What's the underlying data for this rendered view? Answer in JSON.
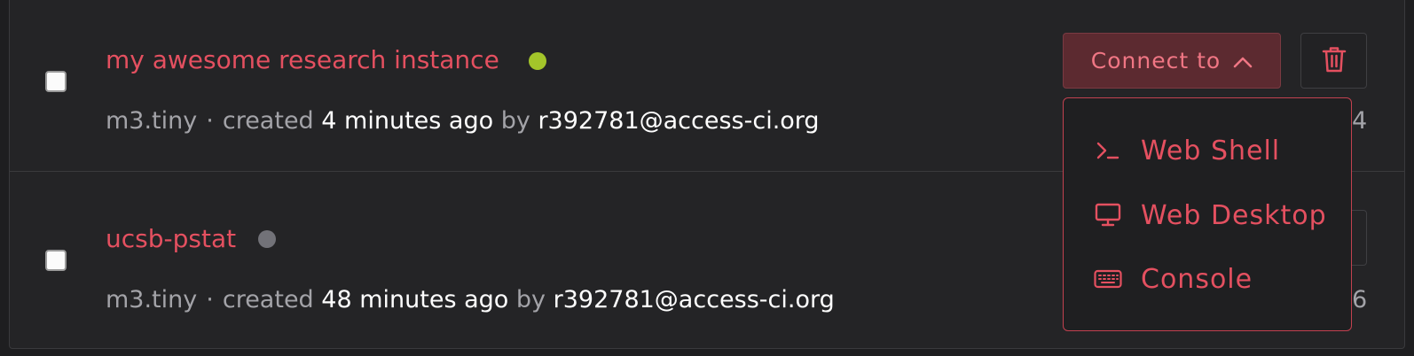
{
  "instances": [
    {
      "name": "my awesome research instance",
      "status_color": "#a3c52a",
      "flavor": "m3.tiny",
      "created_word": "created",
      "created_ago": "4 minutes ago",
      "by_word": "by",
      "owner": "r392781@access-ci.org",
      "trailing_digit": "4"
    },
    {
      "name": "ucsb-pstat",
      "status_color": "#727278",
      "flavor": "m3.tiny",
      "created_word": "created",
      "created_ago": "48 minutes ago",
      "by_word": "by",
      "owner": "r392781@access-ci.org",
      "trailing_digit": "6"
    }
  ],
  "separator": "·",
  "connect_button": {
    "label": "Connect to",
    "icon": "chevron-up-icon"
  },
  "delete_button": {
    "icon": "trash-icon"
  },
  "connect_menu": {
    "items": [
      {
        "label": "Web Shell",
        "icon": "terminal-icon"
      },
      {
        "label": "Web Desktop",
        "icon": "monitor-icon"
      },
      {
        "label": "Console",
        "icon": "keyboard-icon"
      }
    ]
  },
  "colors": {
    "accent": "#e45060",
    "background": "#242426",
    "dropdown_border": "#c2414f"
  }
}
